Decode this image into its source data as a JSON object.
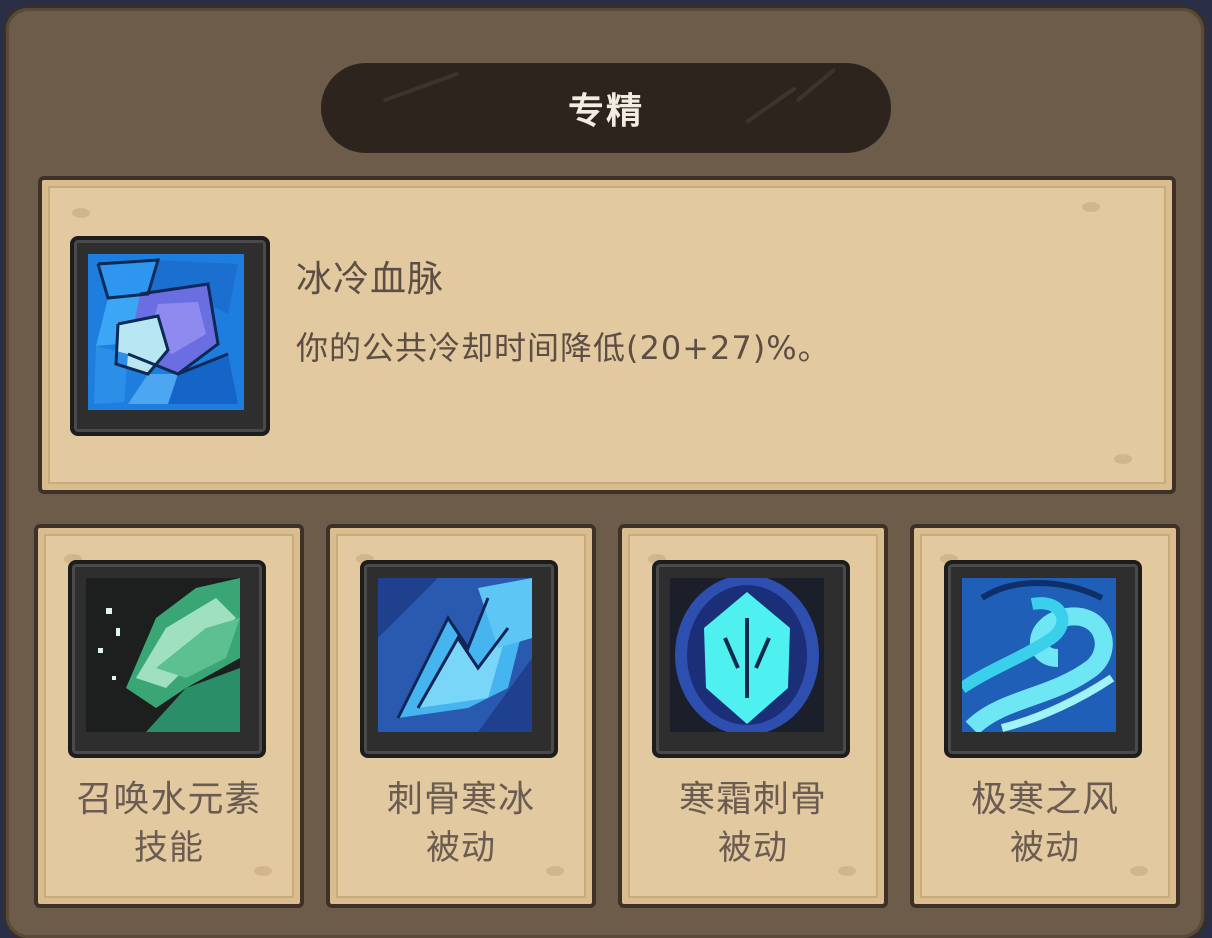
{
  "title": "专精",
  "featured": {
    "name": "冰冷血脉",
    "description": "你的公共冷却时间降低(20+27)%。",
    "icon": "ice-shatter-icon"
  },
  "skills": [
    {
      "name": "召唤水元素",
      "type": "技能",
      "icon": "water-elemental-icon"
    },
    {
      "name": "刺骨寒冰",
      "type": "被动",
      "icon": "ice-shards-icon"
    },
    {
      "name": "寒霜刺骨",
      "type": "被动",
      "icon": "frost-crystal-icon"
    },
    {
      "name": "极寒之风",
      "type": "被动",
      "icon": "frost-wind-icon"
    }
  ],
  "colors": {
    "panel": "#6d5c49",
    "parchment": "#e3c99f",
    "title_bar": "#2c241d",
    "text": "#5c4e44"
  }
}
